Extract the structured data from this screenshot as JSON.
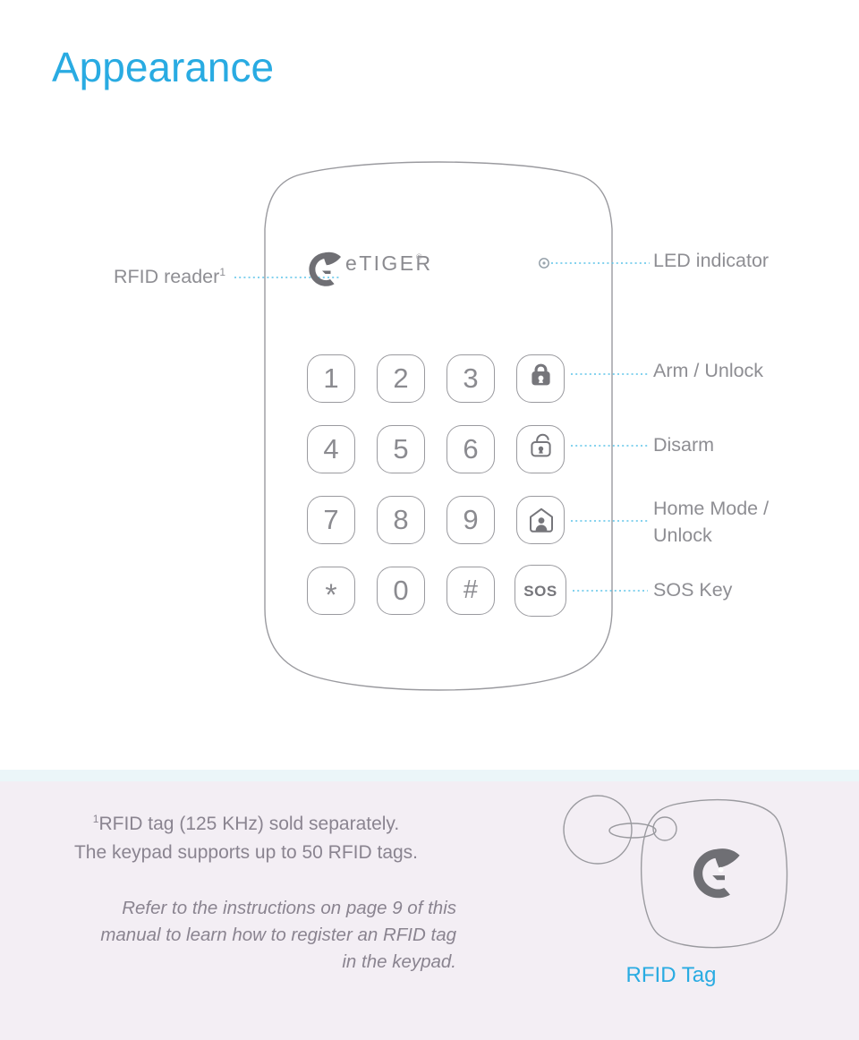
{
  "page": {
    "title": "Appearance",
    "title_color": "#29abe2"
  },
  "theme": {
    "accent": "#29abe2",
    "outline": "#9a9a9f",
    "text_gray": "#8e8e93",
    "footer_bg": "#f3eef4",
    "divider_bg": "#ebf6f9",
    "leader_line": "#5bc4e8"
  },
  "device": {
    "name": "keypad",
    "brand_logo": {
      "icon": "etiger-tiger-head-icon",
      "wordmark": "eTIGER",
      "trademark": "®"
    },
    "led": {
      "icon": "led-indicator-dot-icon"
    },
    "keys": [
      {
        "label": "1",
        "type": "digit"
      },
      {
        "label": "2",
        "type": "digit"
      },
      {
        "label": "3",
        "type": "digit"
      },
      {
        "label": "",
        "type": "function",
        "icon": "lock-closed-icon",
        "name": "arm-unlock-key"
      },
      {
        "label": "4",
        "type": "digit"
      },
      {
        "label": "5",
        "type": "digit"
      },
      {
        "label": "6",
        "type": "digit"
      },
      {
        "label": "",
        "type": "function",
        "icon": "lock-open-icon",
        "name": "disarm-key"
      },
      {
        "label": "7",
        "type": "digit"
      },
      {
        "label": "8",
        "type": "digit"
      },
      {
        "label": "9",
        "type": "digit"
      },
      {
        "label": "",
        "type": "function",
        "icon": "home-person-icon",
        "name": "home-mode-key"
      },
      {
        "label": "*",
        "type": "symbol"
      },
      {
        "label": "0",
        "type": "digit"
      },
      {
        "label": "#",
        "type": "symbol"
      },
      {
        "label": "SOS",
        "type": "function",
        "name": "sos-key"
      }
    ]
  },
  "callouts": {
    "rfid_reader": {
      "text": "RFID reader",
      "footnote_marker": "1"
    },
    "led_indicator": {
      "text": "LED indicator"
    },
    "arm_unlock": {
      "text": "Arm / Unlock"
    },
    "disarm": {
      "text": "Disarm"
    },
    "home_mode_line1": {
      "text": "Home Mode /"
    },
    "home_mode_line2": {
      "text": "Unlock"
    },
    "sos_key": {
      "text": "SOS Key"
    }
  },
  "footer": {
    "footnote_marker": "1",
    "footnote_line1": "RFID tag (125 KHz) sold separately.",
    "footnote_line2": "The keypad supports up to 50 RFID tags.",
    "instruction_line1": "Refer to the instructions on page 9 of this",
    "instruction_line2": "manual to learn how to register an RFID tag",
    "instruction_line3": "in the keypad.",
    "tag_caption": "RFID Tag",
    "tag_logo_icon": "etiger-tiger-head-icon"
  }
}
